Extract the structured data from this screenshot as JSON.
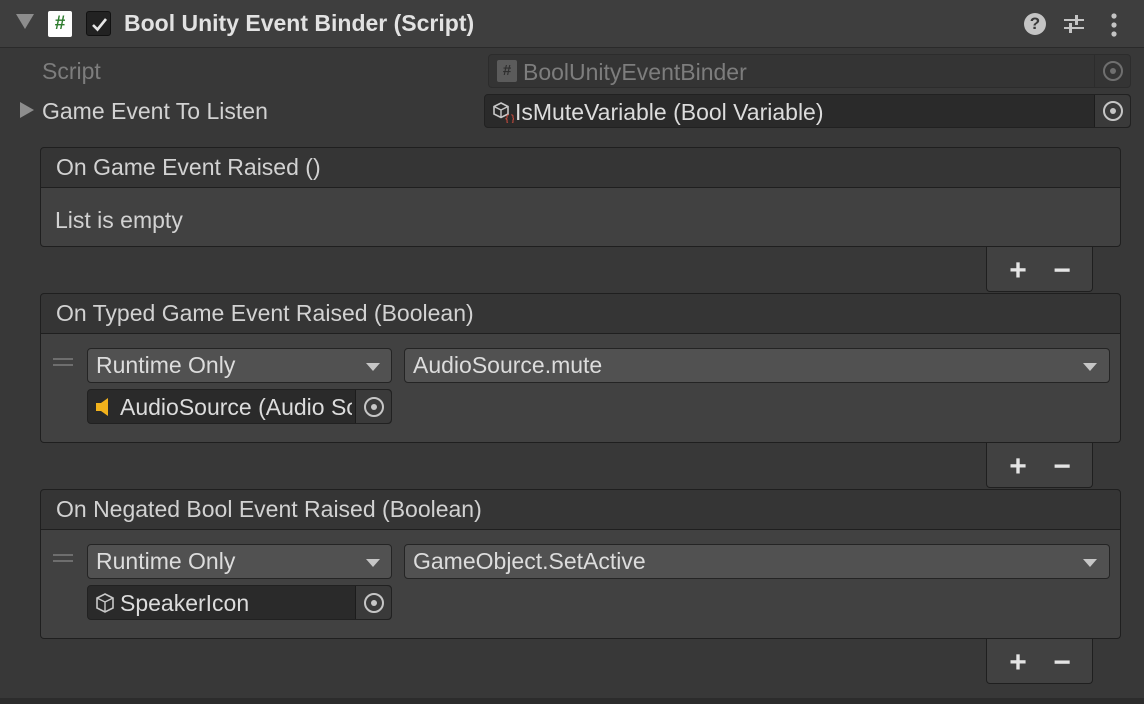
{
  "component": {
    "title": "Bool Unity Event Binder (Script)",
    "enabled": true,
    "icons": [
      "script-icon",
      "help-icon",
      "presets-icon",
      "menu-icon"
    ]
  },
  "script_field": {
    "label": "Script",
    "value": "BoolUnityEventBinder"
  },
  "game_event_field": {
    "label": "Game Event To Listen",
    "value": "IsMuteVariable (Bool Variable)"
  },
  "events": [
    {
      "title": "On Game Event Raised ()",
      "empty_text": "List is empty",
      "add_label": "+",
      "remove_label": "−"
    },
    {
      "title": "On Typed Game Event Raised (Boolean)",
      "listener": {
        "mode": "Runtime Only",
        "function": "AudioSource.mute",
        "target": "AudioSource (Audio Source)",
        "target_icon": "audio-source-icon"
      },
      "add_label": "+",
      "remove_label": "−"
    },
    {
      "title": "On Negated Bool Event Raised (Boolean)",
      "listener": {
        "mode": "Runtime Only",
        "function": "GameObject.SetActive",
        "target": "SpeakerIcon",
        "target_icon": "gameobject-cube-icon"
      },
      "add_label": "+",
      "remove_label": "−"
    }
  ],
  "colors": {
    "background": "#383838",
    "field": "#2a2a2a",
    "dropdown": "#515151",
    "audio_icon": "#f2b21c"
  }
}
